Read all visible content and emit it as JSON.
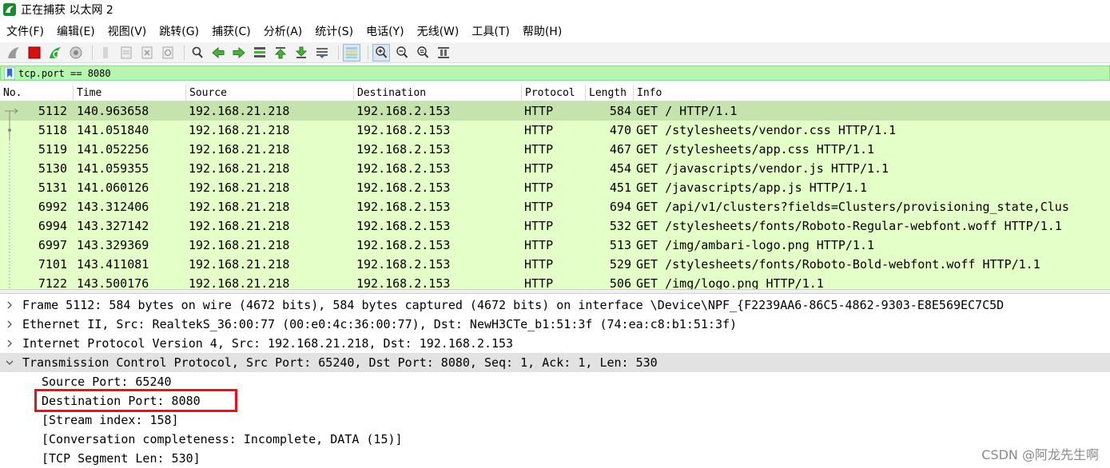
{
  "window": {
    "title": "正在捕获 以太网 2"
  },
  "menu": [
    "文件(F)",
    "编辑(E)",
    "视图(V)",
    "跳转(G)",
    "捕获(C)",
    "分析(A)",
    "统计(S)",
    "电话(Y)",
    "无线(W)",
    "工具(T)",
    "帮助(H)"
  ],
  "toolbar": {
    "buttons": [
      "shark-fin-start-icon",
      "stop-capture-icon",
      "restart-capture-icon",
      "capture-options-icon",
      "open-file-icon",
      "save-file-icon",
      "close-file-icon",
      "reload-file-icon",
      "find-packet-icon",
      "go-back-icon",
      "go-forward-icon",
      "go-to-packet-icon",
      "first-packet-icon",
      "last-packet-icon",
      "autoscroll-icon",
      "colorize-icon",
      "zoom-in-icon",
      "zoom-out-icon",
      "normal-size-icon",
      "resize-columns-icon"
    ]
  },
  "filter": {
    "value": "tcp.port == 8080"
  },
  "columns": [
    "No.",
    "Time",
    "Source",
    "Destination",
    "Protocol",
    "Length",
    "Info"
  ],
  "packets": [
    {
      "no": "5112",
      "time": "140.963658",
      "source": "192.168.21.218",
      "destination": "192.168.2.153",
      "protocol": "HTTP",
      "length": "584",
      "info": "GET / HTTP/1.1"
    },
    {
      "no": "5118",
      "time": "141.051840",
      "source": "192.168.21.218",
      "destination": "192.168.2.153",
      "protocol": "HTTP",
      "length": "470",
      "info": "GET /stylesheets/vendor.css HTTP/1.1"
    },
    {
      "no": "5119",
      "time": "141.052256",
      "source": "192.168.21.218",
      "destination": "192.168.2.153",
      "protocol": "HTTP",
      "length": "467",
      "info": "GET /stylesheets/app.css HTTP/1.1"
    },
    {
      "no": "5130",
      "time": "141.059355",
      "source": "192.168.21.218",
      "destination": "192.168.2.153",
      "protocol": "HTTP",
      "length": "454",
      "info": "GET /javascripts/vendor.js HTTP/1.1"
    },
    {
      "no": "5131",
      "time": "141.060126",
      "source": "192.168.21.218",
      "destination": "192.168.2.153",
      "protocol": "HTTP",
      "length": "451",
      "info": "GET /javascripts/app.js HTTP/1.1"
    },
    {
      "no": "6992",
      "time": "143.312406",
      "source": "192.168.21.218",
      "destination": "192.168.2.153",
      "protocol": "HTTP",
      "length": "694",
      "info": "GET /api/v1/clusters?fields=Clusters/provisioning_state,Clus"
    },
    {
      "no": "6994",
      "time": "143.327142",
      "source": "192.168.21.218",
      "destination": "192.168.2.153",
      "protocol": "HTTP",
      "length": "532",
      "info": "GET /stylesheets/fonts/Roboto-Regular-webfont.woff HTTP/1.1"
    },
    {
      "no": "6997",
      "time": "143.329369",
      "source": "192.168.21.218",
      "destination": "192.168.2.153",
      "protocol": "HTTP",
      "length": "513",
      "info": "GET /img/ambari-logo.png HTTP/1.1"
    },
    {
      "no": "7101",
      "time": "143.411081",
      "source": "192.168.21.218",
      "destination": "192.168.2.153",
      "protocol": "HTTP",
      "length": "529",
      "info": "GET /stylesheets/fonts/Roboto-Bold-webfont.woff HTTP/1.1"
    },
    {
      "no": "7122",
      "time": "143.500176",
      "source": "192.168.21.218",
      "destination": "192.168.2.153",
      "protocol": "HTTP",
      "length": "506",
      "info": "GET /img/logo.png HTTP/1.1"
    }
  ],
  "details": [
    {
      "text": "Frame 5112: 584 bytes on wire (4672 bits), 584 bytes captured (4672 bits) on interface \\Device\\NPF_{F2239AA6-86C5-4862-9303-E8E569EC7C5D",
      "expanded": false,
      "level": 0
    },
    {
      "text": "Ethernet II, Src: RealtekS_36:00:77 (00:e0:4c:36:00:77), Dst: NewH3CTe_b1:51:3f (74:ea:c8:b1:51:3f)",
      "expanded": false,
      "level": 0
    },
    {
      "text": "Internet Protocol Version 4, Src: 192.168.21.218, Dst: 192.168.2.153",
      "expanded": false,
      "level": 0
    },
    {
      "text": "Transmission Control Protocol, Src Port: 65240, Dst Port: 8080, Seq: 1, Ack: 1, Len: 530",
      "expanded": true,
      "level": 0
    },
    {
      "text": "Source Port: 65240",
      "level": 1
    },
    {
      "text": "Destination Port: 8080",
      "level": 1
    },
    {
      "text": "[Stream index: 158]",
      "level": 1
    },
    {
      "text": "[Conversation completeness: Incomplete, DATA (15)]",
      "level": 1
    },
    {
      "text": "[TCP Segment Len: 530]",
      "level": 1
    }
  ],
  "watermark": "CSDN @阿龙先生啊",
  "colors": {
    "row_bg": "#e4ffc7",
    "row_selected": "#c7e3ad",
    "filter_bg": "#b7f5b1",
    "highlight_box": "#e4141b"
  }
}
